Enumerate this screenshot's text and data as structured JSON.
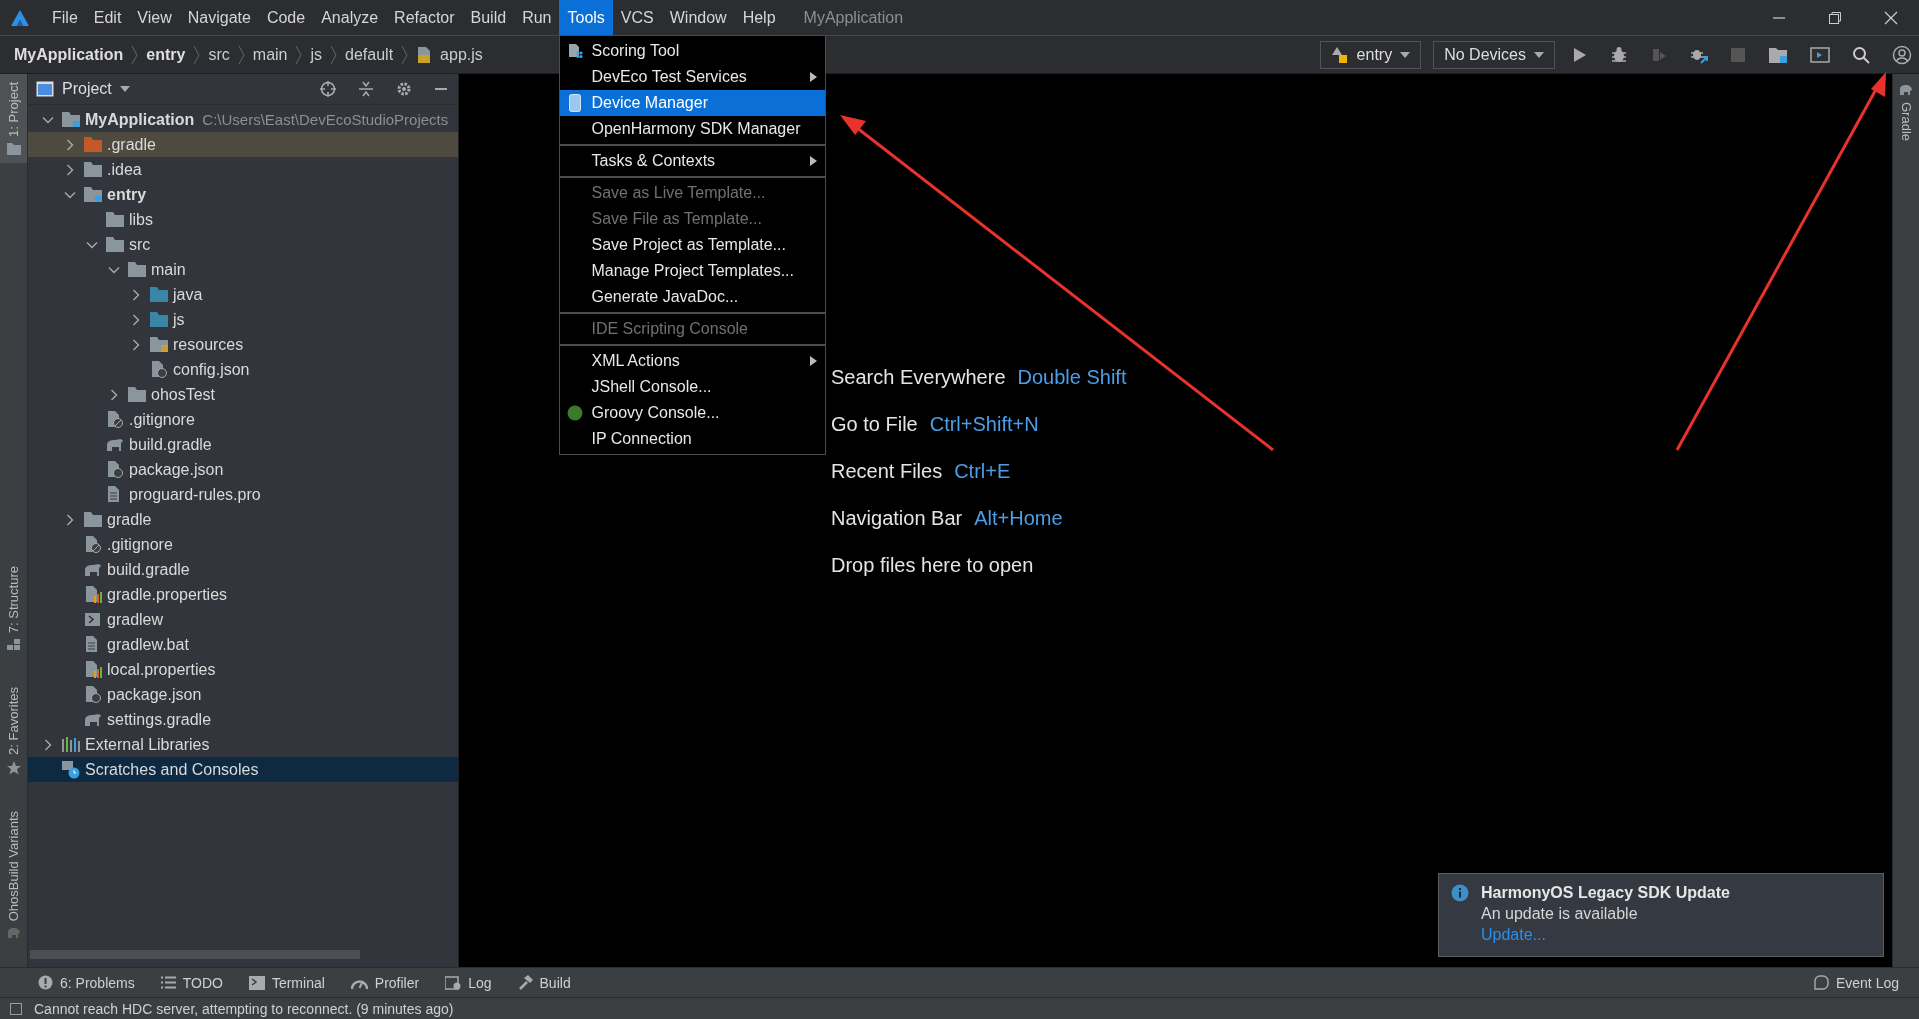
{
  "menu_bar": {
    "items": [
      {
        "label": "File",
        "selected": false
      },
      {
        "label": "Edit",
        "selected": false
      },
      {
        "label": "View",
        "selected": false
      },
      {
        "label": "Navigate",
        "selected": false
      },
      {
        "label": "Code",
        "selected": false
      },
      {
        "label": "Analyze",
        "selected": false
      },
      {
        "label": "Refactor",
        "selected": false
      },
      {
        "label": "Build",
        "selected": false
      },
      {
        "label": "Run",
        "selected": false
      },
      {
        "label": "Tools",
        "selected": true
      },
      {
        "label": "VCS",
        "selected": false
      },
      {
        "label": "Window",
        "selected": false
      },
      {
        "label": "Help",
        "selected": false
      }
    ],
    "title": "MyApplication"
  },
  "breadcrumbs": [
    {
      "label": "MyApplication",
      "kind": "module"
    },
    {
      "label": "entry",
      "kind": "module"
    },
    {
      "label": "src",
      "kind": "folder"
    },
    {
      "label": "main",
      "kind": "folder"
    },
    {
      "label": "js",
      "kind": "folder"
    },
    {
      "label": "default",
      "kind": "folder"
    },
    {
      "label": "app.js",
      "kind": "file"
    }
  ],
  "toolbar": {
    "configuration": "entry",
    "device": "No Devices"
  },
  "left_tool_tabs": [
    {
      "label": "1: Project",
      "selected": true,
      "kind": "project"
    },
    {
      "label": "7: Structure",
      "selected": false,
      "kind": "structure"
    },
    {
      "label": "2: Favorites",
      "selected": false,
      "kind": "favorites"
    },
    {
      "label": "OhosBuild Variants",
      "selected": false,
      "kind": "variants"
    }
  ],
  "right_tool_tabs": [
    {
      "label": "Gradle",
      "selected": false
    }
  ],
  "project_panel": {
    "title": "Project",
    "tree": [
      {
        "label": "MyApplication",
        "path": "C:\\Users\\East\\DevEcoStudioProjects",
        "kind": "module",
        "expanded": true,
        "selected": false,
        "children": [
          {
            "label": ".gradle",
            "kind": "excluded-folder",
            "expanded": false,
            "selected": false
          },
          {
            "label": ".idea",
            "kind": "folder",
            "expanded": false,
            "selected": false
          },
          {
            "label": "entry",
            "kind": "module",
            "expanded": true,
            "selected": false,
            "children": [
              {
                "label": "libs",
                "kind": "folder",
                "selected": false
              },
              {
                "label": "src",
                "kind": "folder",
                "expanded": true,
                "selected": false,
                "children": [
                  {
                    "label": "main",
                    "kind": "folder",
                    "expanded": true,
                    "selected": false,
                    "children": [
                      {
                        "label": "java",
                        "kind": "source-folder",
                        "expanded": false,
                        "selected": false
                      },
                      {
                        "label": "js",
                        "kind": "source-folder",
                        "expanded": false,
                        "selected": false
                      },
                      {
                        "label": "resources",
                        "kind": "resource-folder",
                        "expanded": false,
                        "selected": false
                      },
                      {
                        "label": "config.json",
                        "kind": "json-file",
                        "selected": false
                      }
                    ]
                  },
                  {
                    "label": "ohosTest",
                    "kind": "folder",
                    "expanded": false,
                    "selected": false
                  }
                ]
              },
              {
                "label": ".gitignore",
                "kind": "ignore-file",
                "selected": false
              },
              {
                "label": "build.gradle",
                "kind": "gradle-file",
                "selected": false
              },
              {
                "label": "package.json",
                "kind": "json-file",
                "selected": false
              },
              {
                "label": "proguard-rules.pro",
                "kind": "text-file",
                "selected": false
              }
            ]
          },
          {
            "label": "gradle",
            "kind": "folder",
            "expanded": false,
            "selected": false
          },
          {
            "label": ".gitignore",
            "kind": "ignore-file",
            "selected": false
          },
          {
            "label": "build.gradle",
            "kind": "gradle-file",
            "selected": false
          },
          {
            "label": "gradle.properties",
            "kind": "properties-file",
            "selected": false
          },
          {
            "label": "gradlew",
            "kind": "script-file",
            "selected": false
          },
          {
            "label": "gradlew.bat",
            "kind": "text-file",
            "selected": false
          },
          {
            "label": "local.properties",
            "kind": "properties-file",
            "selected": false
          },
          {
            "label": "package.json",
            "kind": "json-file",
            "selected": false
          },
          {
            "label": "settings.gradle",
            "kind": "gradle-file",
            "selected": false
          }
        ]
      },
      {
        "label": "External Libraries",
        "kind": "libraries",
        "expanded": false,
        "selected": false
      },
      {
        "label": "Scratches and Consoles",
        "kind": "scratches",
        "selected": true
      }
    ]
  },
  "tools_menu": {
    "groups": [
      [
        {
          "label": "Scoring Tool",
          "kind": "scoring",
          "disabled": false,
          "selected": false,
          "submenu": false
        },
        {
          "label": "DevEco Test Services",
          "kind": "plain",
          "disabled": false,
          "selected": false,
          "submenu": true
        },
        {
          "label": "Device Manager",
          "kind": "device",
          "disabled": false,
          "selected": true,
          "submenu": false
        },
        {
          "label": "OpenHarmony SDK Manager",
          "kind": "plain",
          "disabled": false,
          "selected": false,
          "submenu": false
        }
      ],
      [
        {
          "label": "Tasks & Contexts",
          "kind": "plain",
          "disabled": false,
          "selected": false,
          "submenu": true
        }
      ],
      [
        {
          "label": "Save as Live Template...",
          "kind": "plain",
          "disabled": true,
          "selected": false,
          "submenu": false
        },
        {
          "label": "Save File as Template...",
          "kind": "plain",
          "disabled": true,
          "selected": false,
          "submenu": false
        },
        {
          "label": "Save Project as Template...",
          "kind": "plain",
          "disabled": false,
          "selected": false,
          "submenu": false
        },
        {
          "label": "Manage Project Templates...",
          "kind": "plain",
          "disabled": false,
          "selected": false,
          "submenu": false
        },
        {
          "label": "Generate JavaDoc...",
          "kind": "plain",
          "disabled": false,
          "selected": false,
          "submenu": false
        }
      ],
      [
        {
          "label": "IDE Scripting Console",
          "kind": "plain",
          "disabled": true,
          "selected": false,
          "submenu": false
        }
      ],
      [
        {
          "label": "XML Actions",
          "kind": "plain",
          "disabled": false,
          "selected": false,
          "submenu": true
        },
        {
          "label": "JShell Console...",
          "kind": "plain",
          "disabled": false,
          "selected": false,
          "submenu": false
        },
        {
          "label": "Groovy Console...",
          "kind": "groovy",
          "disabled": false,
          "selected": false,
          "submenu": false
        },
        {
          "label": "IP Connection",
          "kind": "plain",
          "disabled": false,
          "selected": false,
          "submenu": false
        }
      ]
    ]
  },
  "editor_hints": [
    {
      "action": "Search Everywhere",
      "shortcut": "Double Shift"
    },
    {
      "action": "Go to File",
      "shortcut": "Ctrl+Shift+N"
    },
    {
      "action": "Recent Files",
      "shortcut": "Ctrl+E"
    },
    {
      "action": "Navigation Bar",
      "shortcut": "Alt+Home"
    },
    {
      "action": "Drop files here to open"
    }
  ],
  "notification": {
    "title": "HarmonyOS Legacy SDK Update",
    "message": "An update is available",
    "link": "Update..."
  },
  "bottom_tools": [
    {
      "label": "6: Problems",
      "kind": "problems"
    },
    {
      "label": "TODO",
      "kind": "todo"
    },
    {
      "label": "Terminal",
      "kind": "terminal"
    },
    {
      "label": "Profiler",
      "kind": "profiler"
    },
    {
      "label": "Log",
      "kind": "log"
    },
    {
      "label": "Build",
      "kind": "build"
    }
  ],
  "event_log": "Event Log",
  "status_bar": {
    "message": "Cannot reach HDC server, attempting to reconnect. (9 minutes ago)"
  }
}
